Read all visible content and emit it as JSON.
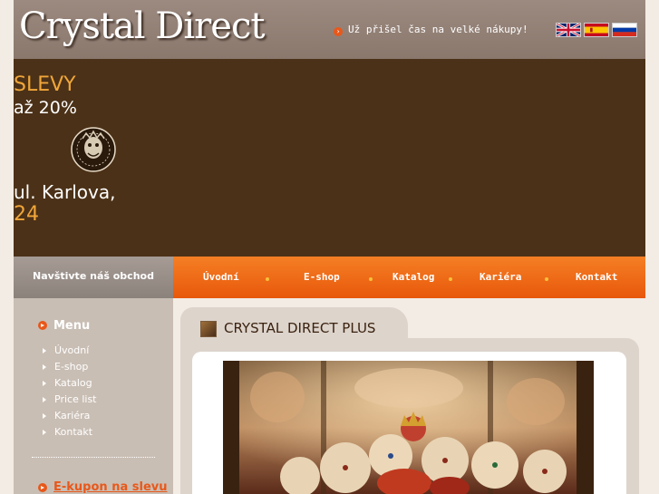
{
  "header": {
    "logo": "Crystal Direct",
    "tagline": "Už přišel čas na velké nákupy!",
    "languages": [
      {
        "name": "English",
        "icon": "uk-flag-icon"
      },
      {
        "name": "Español",
        "icon": "spain-flag-icon"
      },
      {
        "name": "Русский",
        "icon": "russia-flag-icon"
      }
    ]
  },
  "promo": {
    "line1": "SLEVY",
    "line2": "až 20%",
    "street": "ul. Karlova,",
    "number": "24"
  },
  "visit_label": "Navštivte náš obchod",
  "topnav": [
    "Úvodní",
    "E-shop",
    "Katalog",
    "Kariéra",
    "Kontakt"
  ],
  "sidebar": {
    "heading": "Menu",
    "items": [
      "Úvodní",
      "E-shop",
      "Katalog",
      "Price list",
      "Kariéra",
      "Kontakt"
    ],
    "coupon": "E-kupon na slevu"
  },
  "content": {
    "title": "CRYSTAL DIRECT PLUS"
  },
  "colors": {
    "accent": "#e8581a",
    "banner": "#4b3117",
    "header": "#8a786d",
    "gold": "#f0a63a"
  }
}
